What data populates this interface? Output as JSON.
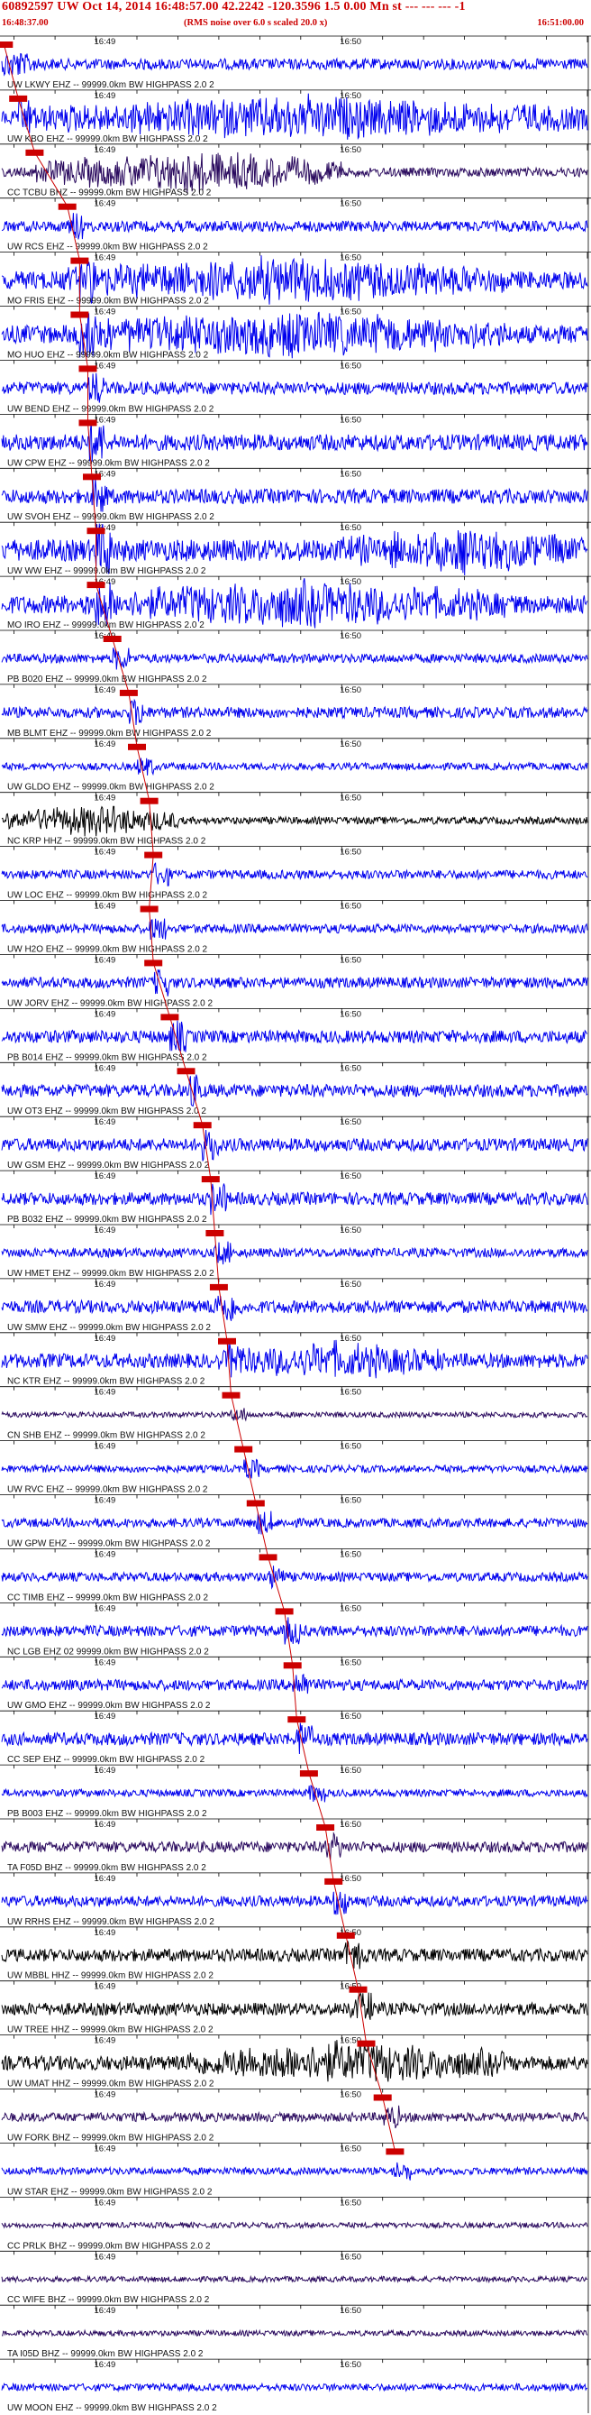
{
  "header": {
    "title": "60892597 UW Oct 14, 2014 16:48:57.00   42.2242 -120.3596  1.5 0.00 Mn st --- --- ---  -1",
    "subtitle": "(RMS noise over 6.0 s scaled 20.0 x)",
    "start_time": "16:48:37.00",
    "end_time": "16:51:00.00"
  },
  "colors": {
    "background": "#ffffff",
    "header_text": "#cc0000",
    "pick_marker": "#cc0000",
    "grid": "#000000",
    "trace_blue": "#0000ee",
    "trace_purple": "#2a0a5e",
    "trace_black": "#000000"
  },
  "chart_data": {
    "type": "line",
    "title": "60892597 UW Oct 14, 2014 16:48:57.00   42.2242 -120.3596  1.5 0.00 Mn st --- --- ---  -1",
    "time_range": [
      "16:48:37.00",
      "16:51:00.00"
    ],
    "minute_labels": [
      "16:49",
      "16:50"
    ],
    "filter_suffix": "99999.0km BW  HIGHPASS  2.0  2",
    "channels": [
      {
        "label": "UW LKWY EHZ -- 99999.0km BW  HIGHPASS  2.0  2",
        "color": "blue",
        "amplitude": 6,
        "pick_time": "16:48:37.5",
        "bursts": [
          {
            "from": "16:48:37",
            "to": "16:48:45",
            "amp": 18
          }
        ]
      },
      {
        "label": "UW KBO EHZ -- 99999.0km BW  HIGHPASS  2.0  2",
        "color": "blue",
        "amplitude": 8,
        "pick_time": "16:48:41",
        "bursts": [
          {
            "from": "16:48:42",
            "to": "16:51:00",
            "amp": 28
          }
        ]
      },
      {
        "label": "CC TCBU BHZ -- 99999.0km BW  HIGHPASS  2.0  2",
        "color": "purple",
        "amplitude": 5,
        "pick_time": "16:48:45",
        "bursts": [
          {
            "from": "16:48:48",
            "to": "16:50:00",
            "amp": 26
          }
        ]
      },
      {
        "label": "UW RCS EHZ -- 99999.0km BW  HIGHPASS  2.0  2",
        "color": "blue",
        "amplitude": 6,
        "pick_time": "16:48:53",
        "bursts": [
          {
            "from": "16:48:55",
            "to": "16:48:57",
            "amp": 14
          }
        ]
      },
      {
        "label": "MO FRIS EHZ -- 99999.0km BW  HIGHPASS  2.0  2",
        "color": "blue",
        "amplitude": 10,
        "pick_time": "16:48:56",
        "bursts": [
          {
            "from": "16:48:52",
            "to": "16:50:40",
            "amp": 30
          }
        ]
      },
      {
        "label": "MO HUO EHZ -- 99999.0km BW  HIGHPASS  2.0  2",
        "color": "blue",
        "amplitude": 10,
        "pick_time": "16:48:56",
        "bursts": [
          {
            "from": "16:48:52",
            "to": "16:50:40",
            "amp": 30
          }
        ]
      },
      {
        "label": "UW BEND EHZ -- 99999.0km BW  HIGHPASS  2.0  2",
        "color": "blue",
        "amplitude": 7,
        "pick_time": "16:48:58",
        "bursts": []
      },
      {
        "label": "UW CPW EHZ -- 99999.0km BW  HIGHPASS  2.0  2",
        "color": "blue",
        "amplitude": 9,
        "pick_time": "16:48:58",
        "bursts": []
      },
      {
        "label": "UW SVOH EHZ -- 99999.0km BW  HIGHPASS  2.0  2",
        "color": "blue",
        "amplitude": 8,
        "pick_time": "16:48:59",
        "bursts": []
      },
      {
        "label": "UW WW EHZ -- 99999.0km BW  HIGHPASS  2.0  2",
        "color": "blue",
        "amplitude": 12,
        "pick_time": "16:49:00",
        "bursts": [
          {
            "from": "16:50:00",
            "to": "16:51:00",
            "amp": 30
          }
        ]
      },
      {
        "label": "MO IRO EHZ -- 99999.0km BW  HIGHPASS  2.0  2",
        "color": "blue",
        "amplitude": 10,
        "pick_time": "16:49:00",
        "bursts": [
          {
            "from": "16:48:57",
            "to": "16:50:40",
            "amp": 30
          }
        ]
      },
      {
        "label": "PB B020 EHZ -- 99999.0km BW  HIGHPASS  2.0  2",
        "color": "blue",
        "amplitude": 5,
        "pick_time": "16:49:04",
        "bursts": []
      },
      {
        "label": "MB BLMT EHZ -- 99999.0km BW  HIGHPASS  2.0  2",
        "color": "blue",
        "amplitude": 6,
        "pick_time": "16:49:08",
        "bursts": []
      },
      {
        "label": "UW GLDO EHZ -- 99999.0km BW  HIGHPASS  2.0  2",
        "color": "blue",
        "amplitude": 4,
        "pick_time": "16:49:10",
        "bursts": []
      },
      {
        "label": "NC KRP HHZ -- 99999.0km BW  HIGHPASS  2.0  2",
        "color": "black",
        "amplitude": 4,
        "pick_time": "16:49:13",
        "bursts": [
          {
            "from": "16:48:38",
            "to": "16:49:20",
            "amp": 20
          }
        ]
      },
      {
        "label": "UW LOC EHZ -- 99999.0km BW  HIGHPASS  2.0  2",
        "color": "blue",
        "amplitude": 5,
        "pick_time": "16:49:14",
        "bursts": []
      },
      {
        "label": "UW H2O EHZ -- 99999.0km BW  HIGHPASS  2.0  2",
        "color": "blue",
        "amplitude": 5,
        "pick_time": "16:49:13",
        "bursts": []
      },
      {
        "label": "UW JORV EHZ -- 99999.0km BW  HIGHPASS  2.0  2",
        "color": "blue",
        "amplitude": 6,
        "pick_time": "16:49:14",
        "bursts": []
      },
      {
        "label": "PB B014 EHZ -- 99999.0km BW  HIGHPASS  2.0  2",
        "color": "blue",
        "amplitude": 7,
        "pick_time": "16:49:18",
        "bursts": []
      },
      {
        "label": "UW OT3 EHZ -- 99999.0km BW  HIGHPASS  2.0  2",
        "color": "blue",
        "amplitude": 7,
        "pick_time": "16:49:22",
        "bursts": []
      },
      {
        "label": "UW GSM EHZ -- 99999.0km BW  HIGHPASS  2.0  2",
        "color": "blue",
        "amplitude": 7,
        "pick_time": "16:49:26",
        "bursts": [
          {
            "from": "16:49:25",
            "to": "16:49:28",
            "amp": 14
          }
        ]
      },
      {
        "label": "PB B032 EHZ -- 99999.0km BW  HIGHPASS  2.0  2",
        "color": "blue",
        "amplitude": 7,
        "pick_time": "16:49:28",
        "bursts": []
      },
      {
        "label": "UW HMET EHZ -- 99999.0km BW  HIGHPASS  2.0  2",
        "color": "blue",
        "amplitude": 5,
        "pick_time": "16:49:29",
        "bursts": []
      },
      {
        "label": "UW SMW EHZ -- 99999.0km BW  HIGHPASS  2.0  2",
        "color": "blue",
        "amplitude": 7,
        "pick_time": "16:49:30",
        "bursts": [
          {
            "from": "16:49:28",
            "to": "16:49:36",
            "amp": 22
          }
        ]
      },
      {
        "label": "NC KTR EHZ -- 99999.0km BW  HIGHPASS  2.0  2",
        "color": "blue",
        "amplitude": 8,
        "pick_time": "16:49:32",
        "bursts": [
          {
            "from": "16:49:30",
            "to": "16:50:25",
            "amp": 24
          }
        ]
      },
      {
        "label": "CN SHB EHZ -- 99999.0km BW  HIGHPASS  2.0  2",
        "color": "purple",
        "amplitude": 3,
        "pick_time": "16:49:33",
        "bursts": []
      },
      {
        "label": "UW RVC EHZ -- 99999.0km BW  HIGHPASS  2.0  2",
        "color": "blue",
        "amplitude": 4,
        "pick_time": "16:49:36",
        "bursts": [
          {
            "from": "16:49:36",
            "to": "16:49:38",
            "amp": 22
          }
        ]
      },
      {
        "label": "UW GPW EHZ -- 99999.0km BW  HIGHPASS  2.0  2",
        "color": "blue",
        "amplitude": 5,
        "pick_time": "16:49:39",
        "bursts": []
      },
      {
        "label": "CC TIMB EHZ -- 99999.0km BW  HIGHPASS  2.0  2",
        "color": "blue",
        "amplitude": 5,
        "pick_time": "16:49:42",
        "bursts": []
      },
      {
        "label": "NC LGB EHZ 02 99999.0km BW  HIGHPASS  2.0  2",
        "color": "blue",
        "amplitude": 6,
        "pick_time": "16:49:46",
        "bursts": []
      },
      {
        "label": "UW GMO EHZ -- 99999.0km BW  HIGHPASS  2.0  2",
        "color": "blue",
        "amplitude": 6,
        "pick_time": "16:49:48",
        "bursts": []
      },
      {
        "label": "CC SEP EHZ -- 99999.0km BW  HIGHPASS  2.0  2",
        "color": "blue",
        "amplitude": 7,
        "pick_time": "16:49:49",
        "bursts": [
          {
            "from": "16:49:48",
            "to": "16:49:52",
            "amp": 18
          }
        ]
      },
      {
        "label": "PB B003 EHZ -- 99999.0km BW  HIGHPASS  2.0  2",
        "color": "blue",
        "amplitude": 4,
        "pick_time": "16:49:52",
        "bursts": []
      },
      {
        "label": "TA F05D BHZ -- 99999.0km BW  HIGHPASS  2.0  2",
        "color": "purple",
        "amplitude": 6,
        "pick_time": "16:49:56",
        "bursts": []
      },
      {
        "label": "UW RRHS EHZ -- 99999.0km BW  HIGHPASS  2.0  2",
        "color": "blue",
        "amplitude": 6,
        "pick_time": "16:49:58",
        "bursts": []
      },
      {
        "label": "UW MBBL HHZ -- 99999.0km BW  HIGHPASS  2.0  2",
        "color": "black",
        "amplitude": 7,
        "pick_time": "16:50:01",
        "bursts": [
          {
            "from": "16:50:00",
            "to": "16:50:06",
            "amp": 20
          }
        ]
      },
      {
        "label": "UW TREE HHZ -- 99999.0km BW  HIGHPASS  2.0  2",
        "color": "black",
        "amplitude": 7,
        "pick_time": "16:50:04",
        "bursts": [
          {
            "from": "16:50:02",
            "to": "16:50:08",
            "amp": 20
          }
        ]
      },
      {
        "label": "UW UMAT HHZ -- 99999.0km BW  HIGHPASS  2.0  2",
        "color": "black",
        "amplitude": 8,
        "pick_time": "16:50:06",
        "bursts": [
          {
            "from": "16:49:22",
            "to": "16:50:40",
            "amp": 28
          }
        ]
      },
      {
        "label": "UW FORK BHZ -- 99999.0km BW  HIGHPASS  2.0  2",
        "color": "purple",
        "amplitude": 5,
        "pick_time": "16:50:10",
        "bursts": []
      },
      {
        "label": "UW STAR EHZ -- 99999.0km BW  HIGHPASS  2.0  2",
        "color": "blue",
        "amplitude": 4,
        "pick_time": "16:50:13",
        "bursts": [
          {
            "from": "16:50:12",
            "to": "16:50:15",
            "amp": 14
          }
        ]
      },
      {
        "label": "CC PRLK BHZ -- 99999.0km BW  HIGHPASS  2.0  2",
        "color": "purple",
        "amplitude": 3,
        "pick_time": "",
        "bursts": []
      },
      {
        "label": "CC WIFE BHZ -- 99999.0km BW  HIGHPASS  2.0  2",
        "color": "purple",
        "amplitude": 3,
        "pick_time": "",
        "bursts": []
      },
      {
        "label": "TA I05D BHZ -- 99999.0km BW  HIGHPASS  2.0  2",
        "color": "purple",
        "amplitude": 3,
        "pick_time": "",
        "bursts": []
      },
      {
        "label": "UW MOON EHZ -- 99999.0km BW  HIGHPASS  2.0  2",
        "color": "blue",
        "amplitude": 4,
        "pick_time": "",
        "bursts": []
      }
    ]
  }
}
